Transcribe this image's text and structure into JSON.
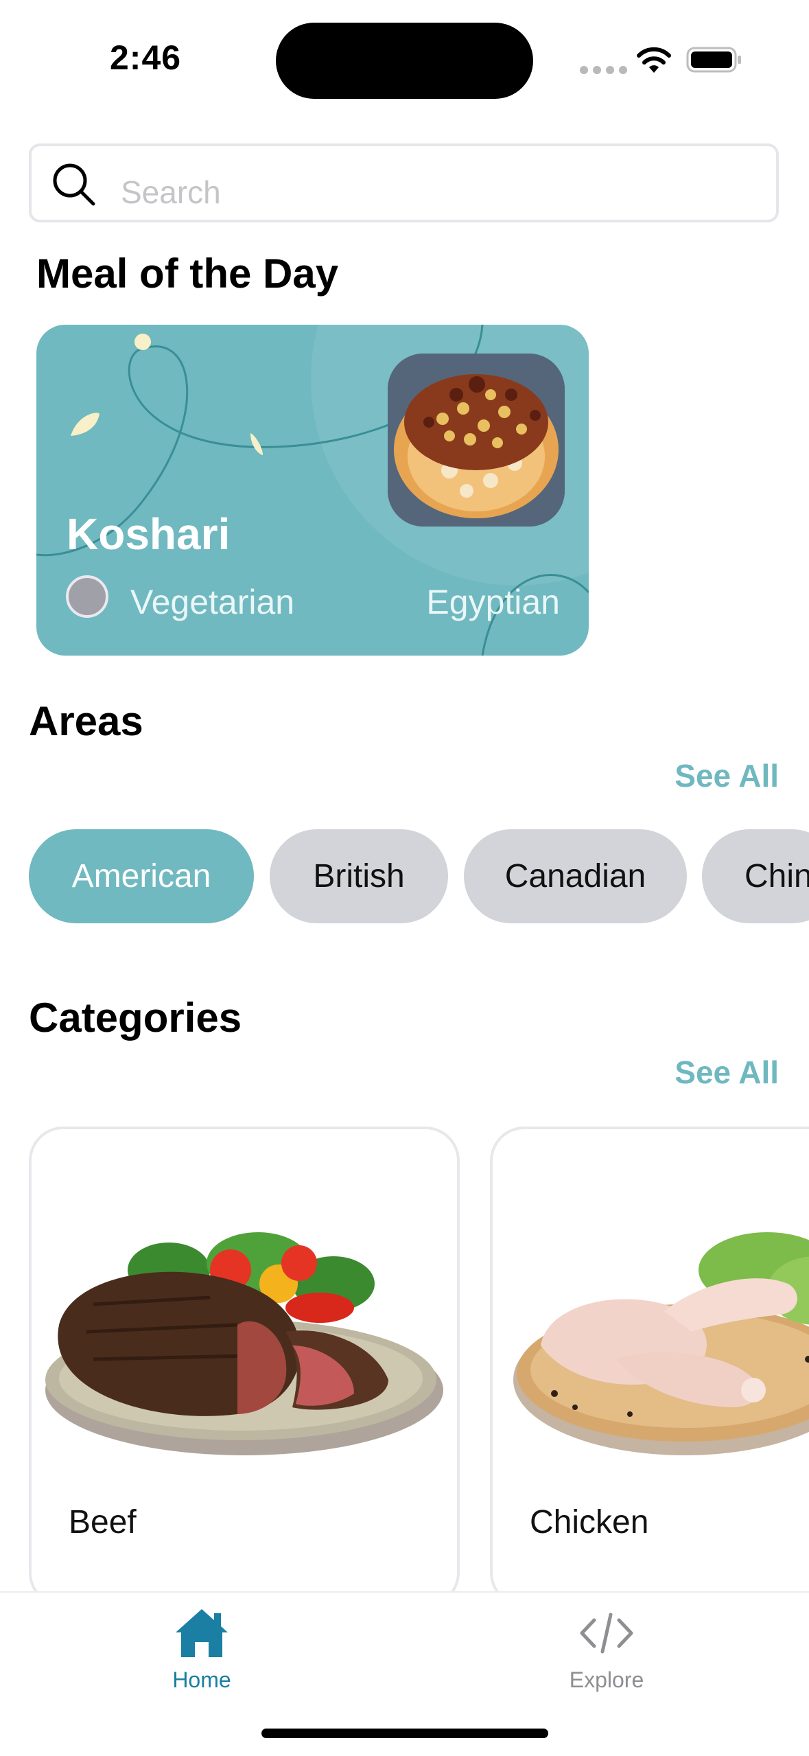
{
  "status_bar": {
    "time": "2:46"
  },
  "search": {
    "placeholder": "Search"
  },
  "meal_of_day": {
    "heading": "Meal of the Day",
    "name": "Koshari",
    "diet": "Vegetarian",
    "area": "Egyptian"
  },
  "areas": {
    "heading": "Areas",
    "see_all": "See All",
    "chips": [
      {
        "label": "American",
        "selected": true
      },
      {
        "label": "British",
        "selected": false
      },
      {
        "label": "Canadian",
        "selected": false
      },
      {
        "label": "Chin",
        "selected": false
      }
    ]
  },
  "categories": {
    "heading": "Categories",
    "see_all": "See All",
    "items": [
      {
        "label": "Beef"
      },
      {
        "label": "Chicken"
      }
    ]
  },
  "tab_bar": {
    "tabs": [
      {
        "label": "Home",
        "icon": "house-icon",
        "active": true
      },
      {
        "label": "Explore",
        "icon": "code-icon",
        "active": false
      }
    ]
  },
  "colors": {
    "accent": "#70b9c0",
    "tab_active": "#1a7fa3",
    "tab_inactive": "#8e8e93",
    "chip_inactive": "#d2d4d9"
  }
}
